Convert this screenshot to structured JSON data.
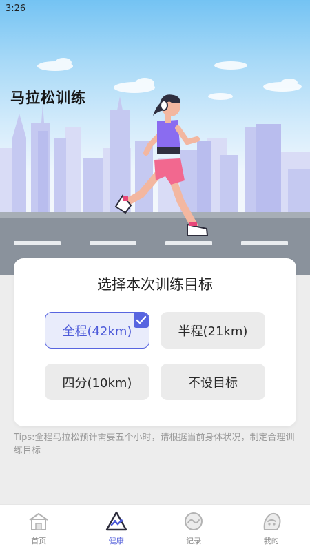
{
  "status_bar": {
    "time": "3:26"
  },
  "hero": {
    "title": "马拉松训练"
  },
  "card": {
    "title": "选择本次训练目标",
    "options": [
      {
        "label": "全程(42km)",
        "selected": true
      },
      {
        "label": "半程(21km)",
        "selected": false
      },
      {
        "label": "四分(10km)",
        "selected": false
      },
      {
        "label": "不设目标",
        "selected": false
      }
    ]
  },
  "tips": "Tips:全程马拉松预计需要五个小时，请根据当前身体状况，制定合理训练目标",
  "tabbar": {
    "tabs": [
      {
        "label": "首页",
        "icon": "home-icon",
        "active": false
      },
      {
        "label": "健康",
        "icon": "health-icon",
        "active": true
      },
      {
        "label": "记录",
        "icon": "record-icon",
        "active": false
      },
      {
        "label": "我的",
        "icon": "profile-icon",
        "active": false
      }
    ]
  },
  "colors": {
    "accent": "#4d5ad9",
    "tab_inactive": "#8e8e8e",
    "option_bg": "#ebebeb",
    "page_bg": "#ededed"
  }
}
